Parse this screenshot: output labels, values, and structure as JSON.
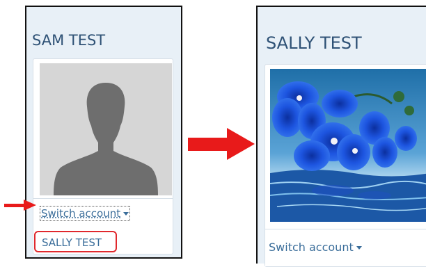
{
  "left_panel": {
    "user_name": "SAM TEST",
    "avatar": "default-silhouette",
    "switch_label": "Switch account",
    "alternate_account": "SALLY TEST"
  },
  "right_panel": {
    "user_name": "SALLY TEST",
    "avatar": "blue-orchid-photo",
    "switch_label": "Switch account"
  },
  "annotations": {
    "pointer_arrow_color": "#e81a1a",
    "transition_arrow_color": "#e81a1a",
    "highlight_color": "#e0282d"
  },
  "colors": {
    "panel_background": "#e8f0f7",
    "name_text": "#2f5276",
    "link_text": "#3a6d9a"
  }
}
